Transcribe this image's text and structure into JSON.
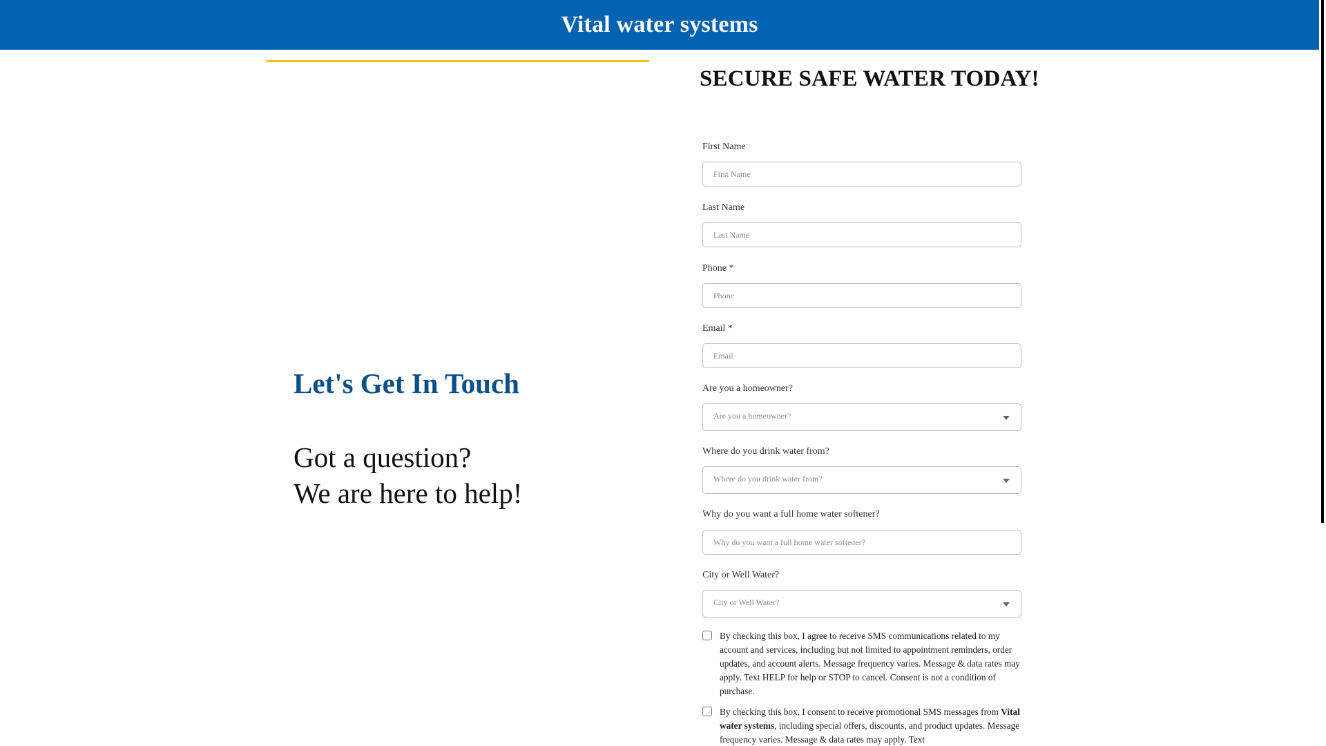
{
  "header": {
    "title": "Vital water systems"
  },
  "left": {
    "title": "Let's Get In Touch",
    "line1": "Got a question?",
    "line2": "We are here to help!"
  },
  "form": {
    "heading": "SECURE SAFE WATER TODAY!",
    "first_name": {
      "label": "First Name",
      "placeholder": "First Name"
    },
    "last_name": {
      "label": "Last Name",
      "placeholder": "Last Name"
    },
    "phone": {
      "label": "Phone *",
      "placeholder": "Phone"
    },
    "email": {
      "label": "Email *",
      "placeholder": "Email"
    },
    "homeowner": {
      "label": "Are you a homeowner?",
      "value": "Are you a homeowner?"
    },
    "water_source": {
      "label": "Where do you drink water from?",
      "value": "Where do you drink water from?"
    },
    "softener_reason": {
      "label": "Why do you want a full home water softener?",
      "placeholder": "Why do you want a full home water softener?"
    },
    "city_well": {
      "label": "City or Well Water?",
      "value": "City or Well Water?"
    },
    "consent1": "By checking this box, I agree to receive SMS communications related to my account and services, including but not limited to appointment reminders, order updates, and account alerts. Message frequency varies. Message & data rates may apply. Text HELP for help or STOP to cancel. Consent is not a condition of purchase.",
    "consent2": {
      "before": "By checking this box, I consent to receive promotional SMS messages from ",
      "brand": "Vital water systems",
      "after": ", including special offers, discounts, and product updates. Message frequency varies. Message & data rates may apply. Text"
    }
  }
}
